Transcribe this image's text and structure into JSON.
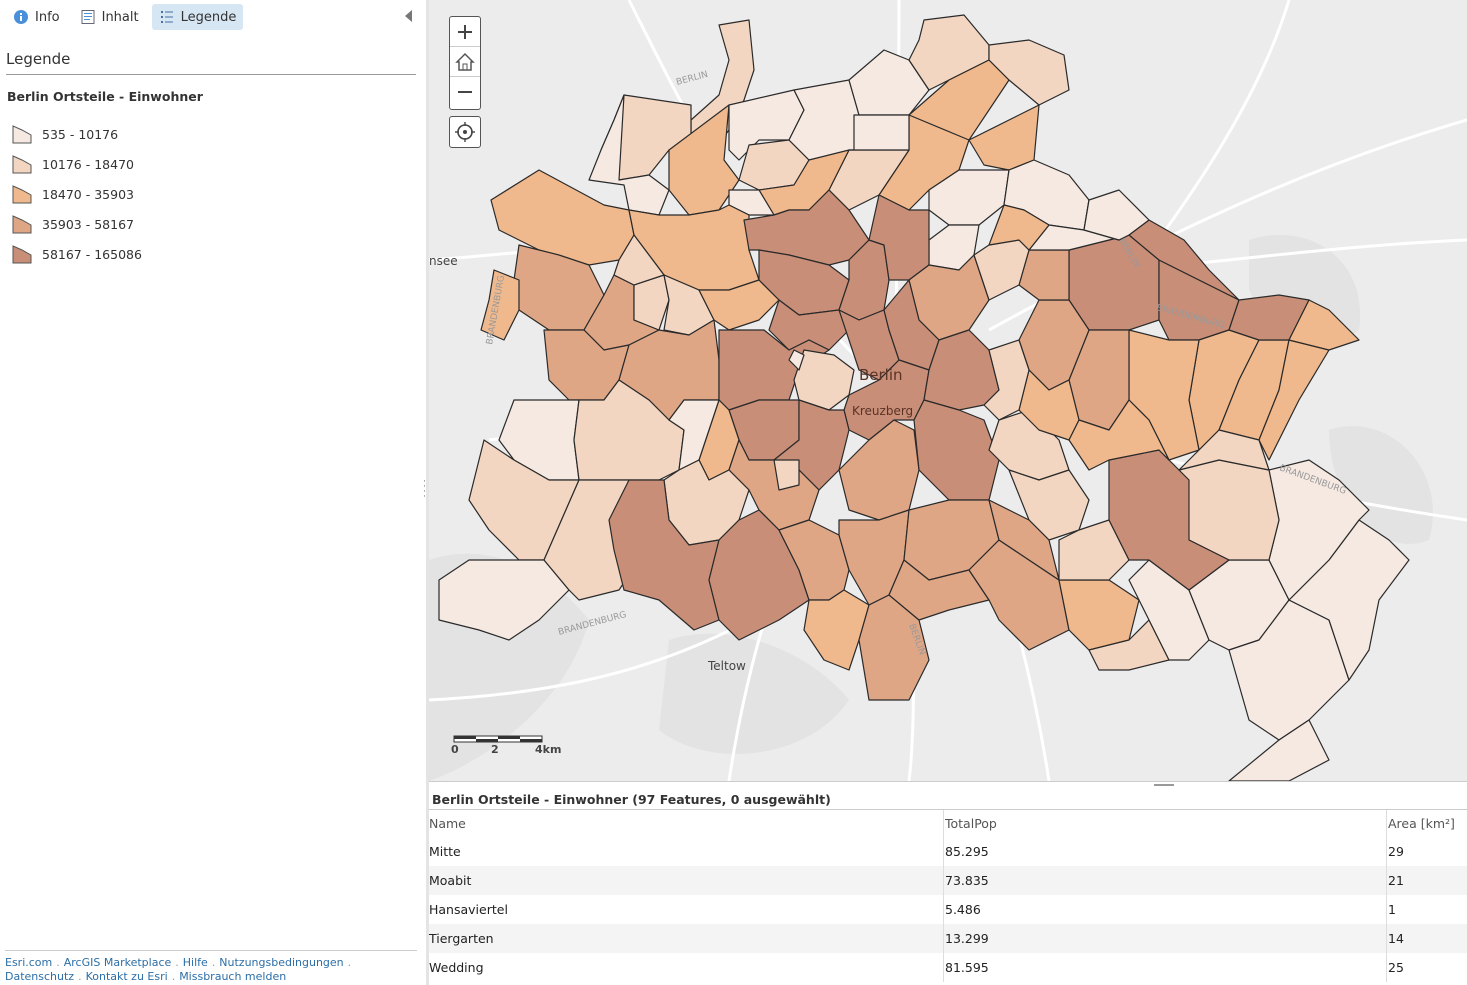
{
  "tabs": [
    {
      "label": "Info",
      "icon": "info-icon"
    },
    {
      "label": "Inhalt",
      "icon": "content-icon"
    },
    {
      "label": "Legende",
      "icon": "legend-icon",
      "active": true
    }
  ],
  "legend": {
    "heading": "Legende",
    "layer_title": "Berlin Ortsteile - Einwohner",
    "classes": [
      {
        "label": "535 - 10176",
        "color": "#f5e9e2"
      },
      {
        "label": "10176 - 18470",
        "color": "#f2d6c2"
      },
      {
        "label": "18470 - 35903",
        "color": "#f0b98d"
      },
      {
        "label": "35903 - 58167",
        "color": "#dfa686"
      },
      {
        "label": "58167 - 165086",
        "color": "#c98e78"
      }
    ]
  },
  "footer": {
    "links_row1": [
      "Esri.com",
      "ArcGIS Marketplace",
      "Hilfe",
      "Nutzungsbedingungen"
    ],
    "links_row2": [
      "Datenschutz",
      "Kontakt zu Esri",
      "Missbrauch melden"
    ]
  },
  "map": {
    "labels": {
      "city": "Berlin",
      "district": "Kreuzberg",
      "town_south": "Teltow",
      "lake_west": "nsee",
      "brandenburg": "BRANDENBURG",
      "berlin_small": "BERLIN"
    },
    "scale": {
      "t0": "0",
      "t1": "2",
      "t2": "4km"
    },
    "colors": {
      "background": "#ececec",
      "roads": "#ffffff",
      "boundary": "#2a2a2a"
    }
  },
  "table": {
    "title": "Berlin Ortsteile - Einwohner (97 Features, 0 ausgewählt)",
    "columns": [
      "Name",
      "TotalPop",
      "Area [km²]"
    ],
    "rows": [
      [
        "Mitte",
        "85.295",
        "29"
      ],
      [
        "Moabit",
        "73.835",
        "21"
      ],
      [
        "Hansaviertel",
        "5.486",
        "1"
      ],
      [
        "Tiergarten",
        "13.299",
        "14"
      ],
      [
        "Wedding",
        "81.595",
        "25"
      ]
    ]
  }
}
